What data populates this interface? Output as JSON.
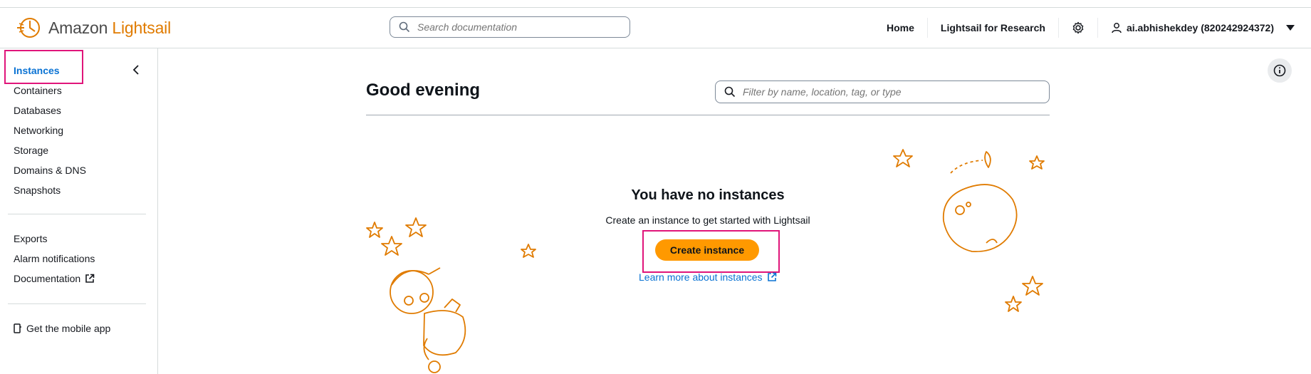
{
  "app": {
    "brand_prefix": "Amazon",
    "brand_name": "Lightsail"
  },
  "header": {
    "search_placeholder": "Search documentation",
    "nav": [
      "Home",
      "Lightsail for Research"
    ],
    "user_label": "ai.abhishekdey (820242924372)"
  },
  "sidebar": {
    "primary": [
      {
        "label": "Instances",
        "active": true
      },
      {
        "label": "Containers"
      },
      {
        "label": "Databases"
      },
      {
        "label": "Networking"
      },
      {
        "label": "Storage"
      },
      {
        "label": "Domains & DNS"
      },
      {
        "label": "Snapshots"
      }
    ],
    "secondary": [
      {
        "label": "Exports"
      },
      {
        "label": "Alarm notifications"
      },
      {
        "label": "Documentation"
      }
    ],
    "mobile_app": "Get the mobile app"
  },
  "main": {
    "greeting": "Good evening",
    "filter_placeholder": "Filter by name, location, tag, or type",
    "empty_title": "You have no instances",
    "empty_desc": "Create an instance to get started with Lightsail",
    "create_button": "Create instance",
    "learn_more": "Learn more about instances"
  },
  "colors": {
    "accent": "#ff9900",
    "link": "#0972d3",
    "highlight": "#e0157a",
    "illustration": "#e07b00"
  },
  "icons": [
    "lightsail-logo-icon",
    "search-icon",
    "gear-icon",
    "user-icon",
    "caret-down-icon",
    "chevron-left-icon",
    "external-link-icon",
    "mobile-icon",
    "info-icon",
    "filter-search-icon"
  ]
}
